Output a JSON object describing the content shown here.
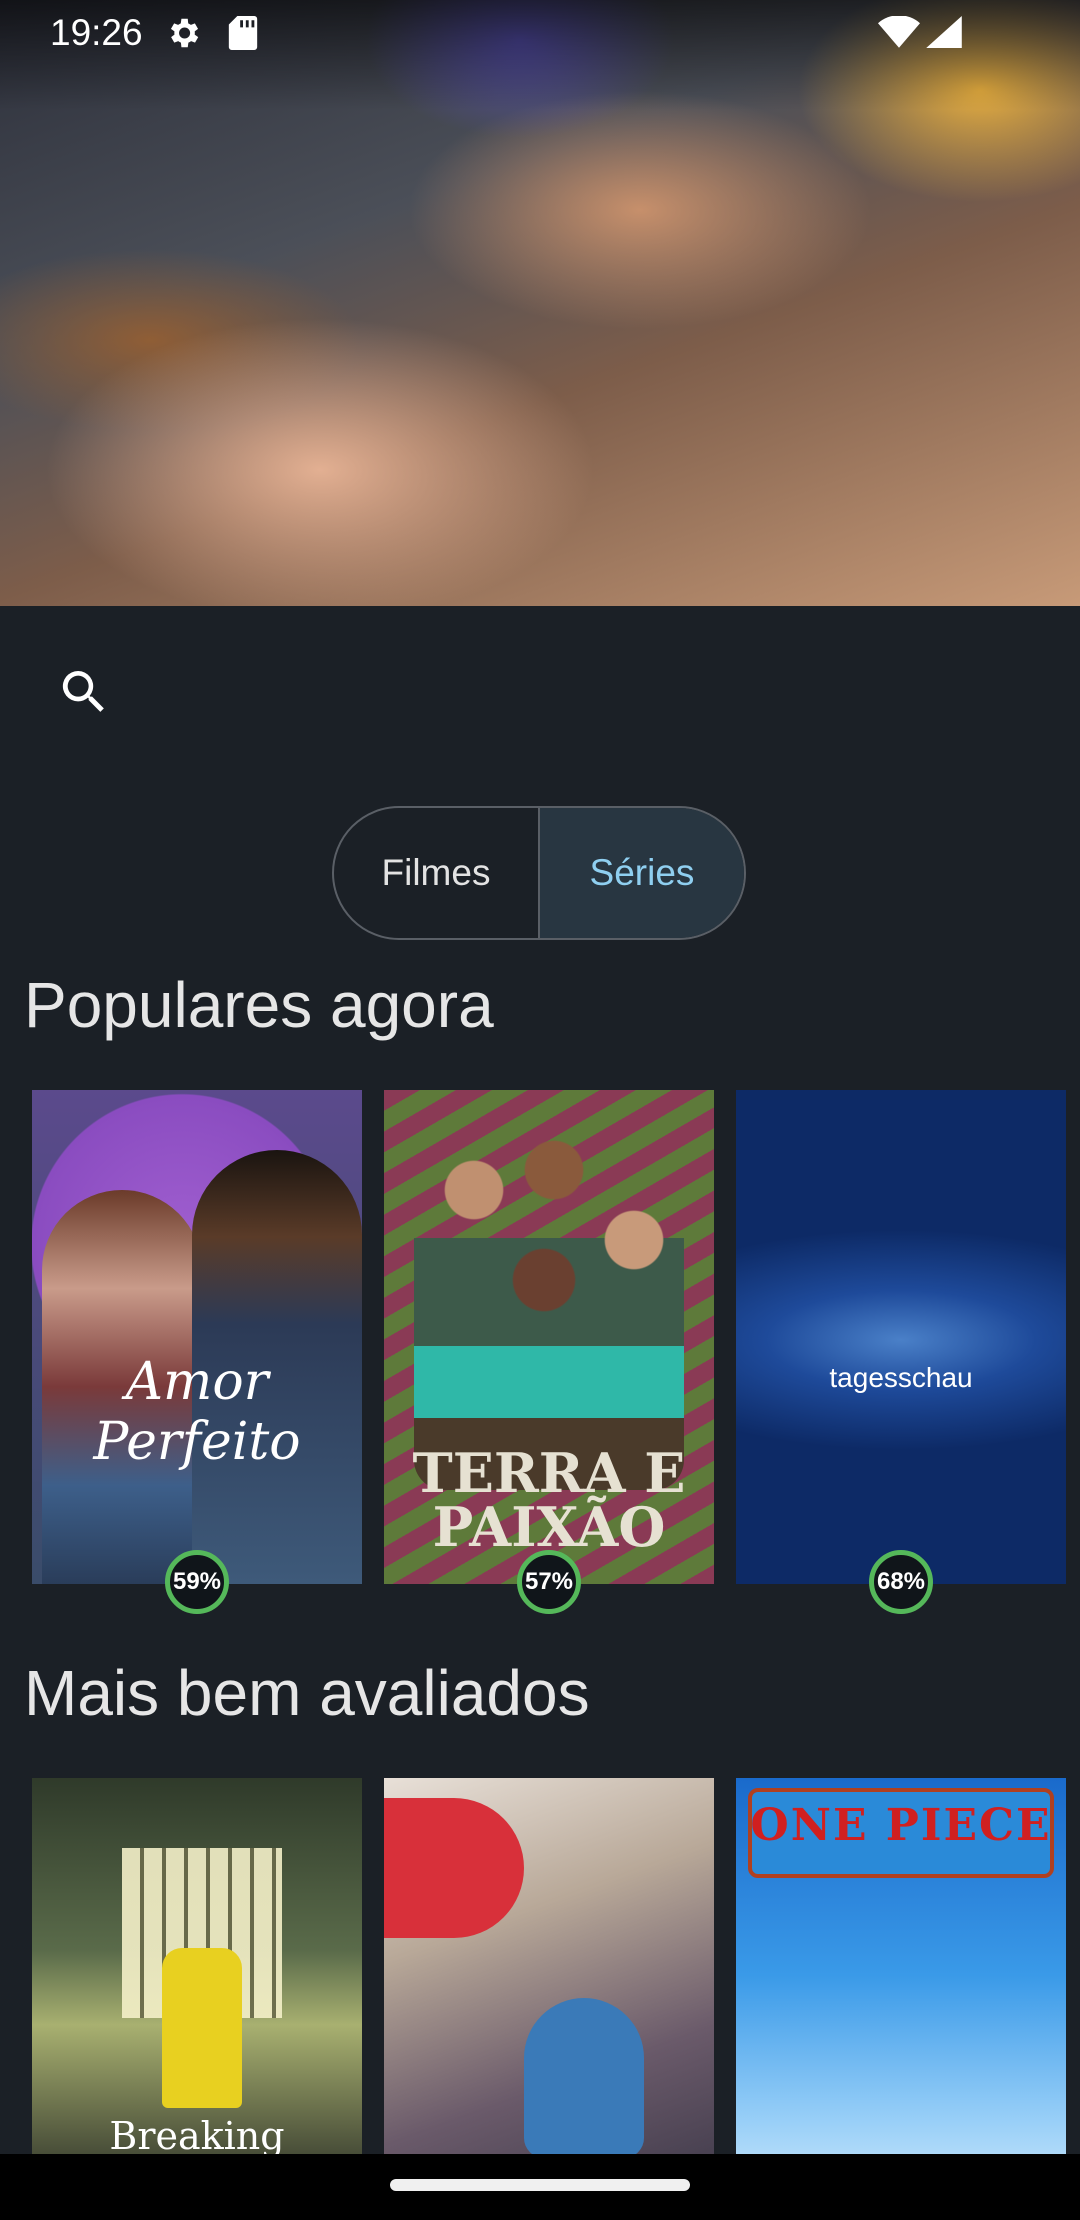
{
  "status_bar": {
    "time": "19:26",
    "icons": [
      "settings-icon",
      "sd-card-icon",
      "wifi-icon",
      "signal-icon"
    ]
  },
  "hero": {
    "image": "featured-movie-backdrop"
  },
  "search": {
    "icon": "search-icon"
  },
  "segmented": {
    "options": [
      "Filmes",
      "Séries"
    ],
    "selected": "Séries"
  },
  "popular": {
    "title": "Populares agora",
    "items": [
      {
        "poster_text": "Amor Perfeito",
        "rating": "59%"
      },
      {
        "poster_text": "TERRA E PAIXÃO",
        "rating": "57%"
      },
      {
        "poster_text": "tagesschau",
        "rating": "68%"
      }
    ]
  },
  "top_rated": {
    "title": "Mais bem avaliados",
    "items": [
      {
        "poster_text": "Breaking"
      },
      {
        "poster_text": ""
      },
      {
        "poster_text": "ONE PIECE"
      }
    ]
  },
  "colors": {
    "background": "#1b2026",
    "accent": "#8fcff0",
    "rating_ring": "#55b85a"
  }
}
